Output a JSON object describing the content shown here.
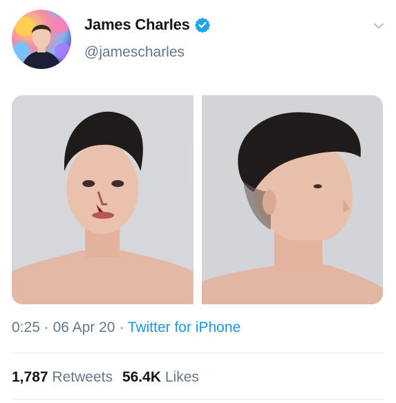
{
  "author": {
    "display_name": "James Charles",
    "handle": "@jamescharles",
    "verified": true
  },
  "icons": {
    "verified": "verified-badge-icon",
    "more": "chevron-down-icon"
  },
  "media": {
    "photos": [
      "front-portrait-photo",
      "side-profile-photo"
    ]
  },
  "meta": {
    "time": "0:25",
    "date": "06 Apr 20",
    "source": "Twitter for iPhone",
    "separator": "·"
  },
  "stats": {
    "retweets_count": "1,787",
    "retweets_label": "Retweets",
    "likes_count": "56.4K",
    "likes_label": "Likes"
  },
  "colors": {
    "text_primary": "#14171a",
    "text_secondary": "#657786",
    "link": "#1b95e0",
    "verified": "#1da1f2",
    "divider": "#e6ecf0"
  }
}
